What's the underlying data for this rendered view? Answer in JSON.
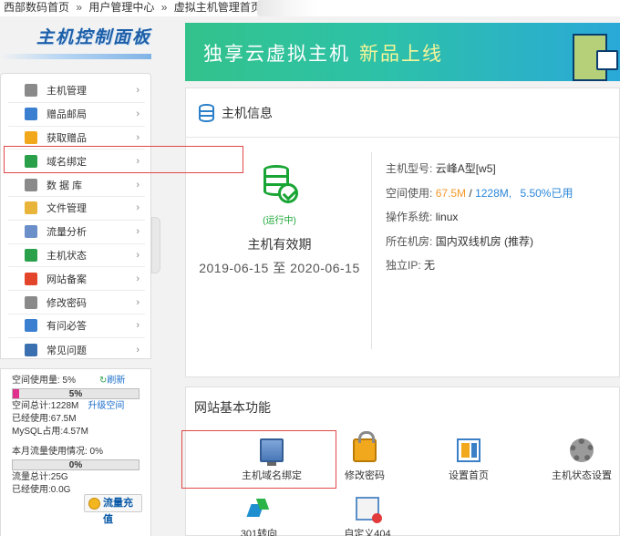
{
  "breadcrumb": {
    "items": [
      "西部数码首页",
      "用户管理中心",
      "虚拟主机管理首页"
    ],
    "separator": "»"
  },
  "brand": {
    "title": "主机控制面板"
  },
  "sidebar": {
    "items": [
      {
        "label": "主机管理",
        "icon": "server-icon",
        "color": "#8a8a8a"
      },
      {
        "label": "赠品邮局",
        "icon": "mail-icon",
        "color": "#3a7fd0"
      },
      {
        "label": "获取赠品",
        "icon": "gift-icon",
        "color": "#f2a81d"
      },
      {
        "label": "域名绑定",
        "icon": "globe-icon",
        "color": "#2aa04a"
      },
      {
        "label": "数 据 库",
        "icon": "database-icon",
        "color": "#8a8a8a"
      },
      {
        "label": "文件管理",
        "icon": "file-manager-icon",
        "color": "#e8b53a"
      },
      {
        "label": "流量分析",
        "icon": "traffic-chart-icon",
        "color": "#6b8fc8"
      },
      {
        "label": "主机状态",
        "icon": "status-icon",
        "color": "#2aa04a"
      },
      {
        "label": "网站备案",
        "icon": "filing-icon",
        "color": "#e2452a"
      },
      {
        "label": "修改密码",
        "icon": "password-icon",
        "color": "#8a8a8a"
      },
      {
        "label": "有问必答",
        "icon": "support-icon",
        "color": "#3a7fd0"
      },
      {
        "label": "常见问题",
        "icon": "faq-icon",
        "color": "#3a6fb0"
      }
    ],
    "arrow": "›"
  },
  "usage": {
    "space_used_label": "空间使用量: 5%",
    "refresh_label": "刷新",
    "space_pct": "5%",
    "space_pct_value": 5,
    "space_total": "空间总计:1228M",
    "upgrade_label": "升级空间",
    "space_used": "已经使用:67.5M",
    "mysql_used": "MySQL占用:4.57M",
    "traffic_label": "本月流量使用情况: 0%",
    "traffic_pct": "0%",
    "traffic_pct_value": 0,
    "traffic_total": "流量总计:25G",
    "traffic_used": "已经使用:0.0G",
    "recharge_label": "流量充值"
  },
  "banner": {
    "text": "独享云虚拟主机",
    "highlight": "新品上线"
  },
  "host_info": {
    "title": "主机信息",
    "status": "(运行中)",
    "validity_label": "主机有效期",
    "validity_range": "2019-06-15 至 2020-06-15",
    "model_key": "主机型号:",
    "model_val": "云峰A型[w5]",
    "space_key": "空间使用:",
    "space_used": "67.5M",
    "space_sep": " / ",
    "space_total": "1228M,",
    "space_pct": "5.50%已用",
    "os_key": "操作系统:",
    "os_val": "linux",
    "room_key": "所在机房:",
    "room_val": "国内双线机房 (推荐)",
    "ip_key": "独立IP:",
    "ip_val": "无"
  },
  "features": {
    "title": "网站基本功能",
    "items": [
      {
        "label": "主机域名绑定",
        "icon": "computer-icon"
      },
      {
        "label": "修改密码",
        "icon": "lock-icon"
      },
      {
        "label": "设置首页",
        "icon": "homepage-settings-icon"
      },
      {
        "label": "主机状态设置",
        "icon": "gear-icon"
      },
      {
        "label": "301转向",
        "icon": "redirect-icon"
      },
      {
        "label": "自定义404",
        "icon": "custom-404-icon"
      }
    ]
  }
}
